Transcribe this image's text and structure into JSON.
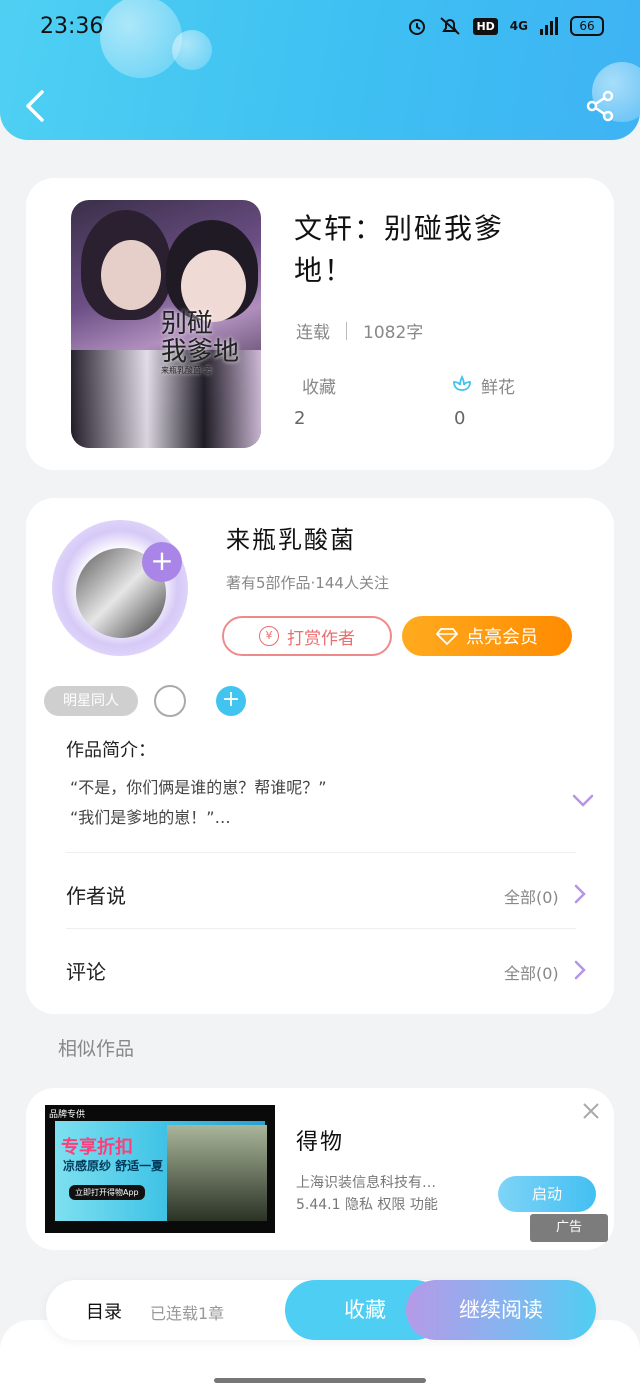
{
  "status_bar": {
    "time": "23:36",
    "network": "4G",
    "hd": "HD",
    "battery": "66"
  },
  "book": {
    "title": "文轩：别碰我爹地！",
    "status": "连载",
    "word_count": "1082字",
    "favorites_label": "收藏",
    "favorites_count": "2",
    "flowers_label": "鲜花",
    "flowers_count": "0",
    "cover_title_line1": "别碰",
    "cover_title_line2": "我爹地",
    "cover_subtitle": "来瓶乳酸菌 著"
  },
  "author": {
    "name": "来瓶乳酸菌",
    "meta": "著有5部作品·144人关注",
    "tip_label": "打赏作者",
    "tip_icon_glyph": "¥",
    "vip_label": "点亮会员"
  },
  "tags": {
    "star_tag": "明星同人",
    "add_glyph": "+"
  },
  "intro": {
    "title": "作品简介：",
    "line1": "“不是，你们俩是谁的崽？帮谁呢？”",
    "line2": "“我们是爹地的崽！”…"
  },
  "rows": {
    "author_says_label": "作者说",
    "author_says_count": "全部(0)",
    "comments_label": "评论",
    "comments_count": "全部(0)"
  },
  "similar": {
    "section_title": "相似作品"
  },
  "ad": {
    "title": "得物",
    "desc_line1": "上海识装信息科技有…",
    "desc_line2": "5.44.1  隐私  权限  功能",
    "launch_label": "启动",
    "badge": "广告",
    "img_brand": "品牌专供",
    "img_headline": "专享折扣",
    "img_sub": "凉感原纱 舒适一夏",
    "img_cta": "立即打开得物App"
  },
  "bottom_bar": {
    "toc_label": "目录",
    "toc_status": "已连载1章",
    "fav_label": "收藏",
    "read_label": "继续阅读"
  },
  "colors": {
    "header_accent": "#3ec0f2",
    "vip_orange": "#ff9a10",
    "tip_red": "#ea6e6e",
    "avatar_plus": "#a985e8"
  }
}
